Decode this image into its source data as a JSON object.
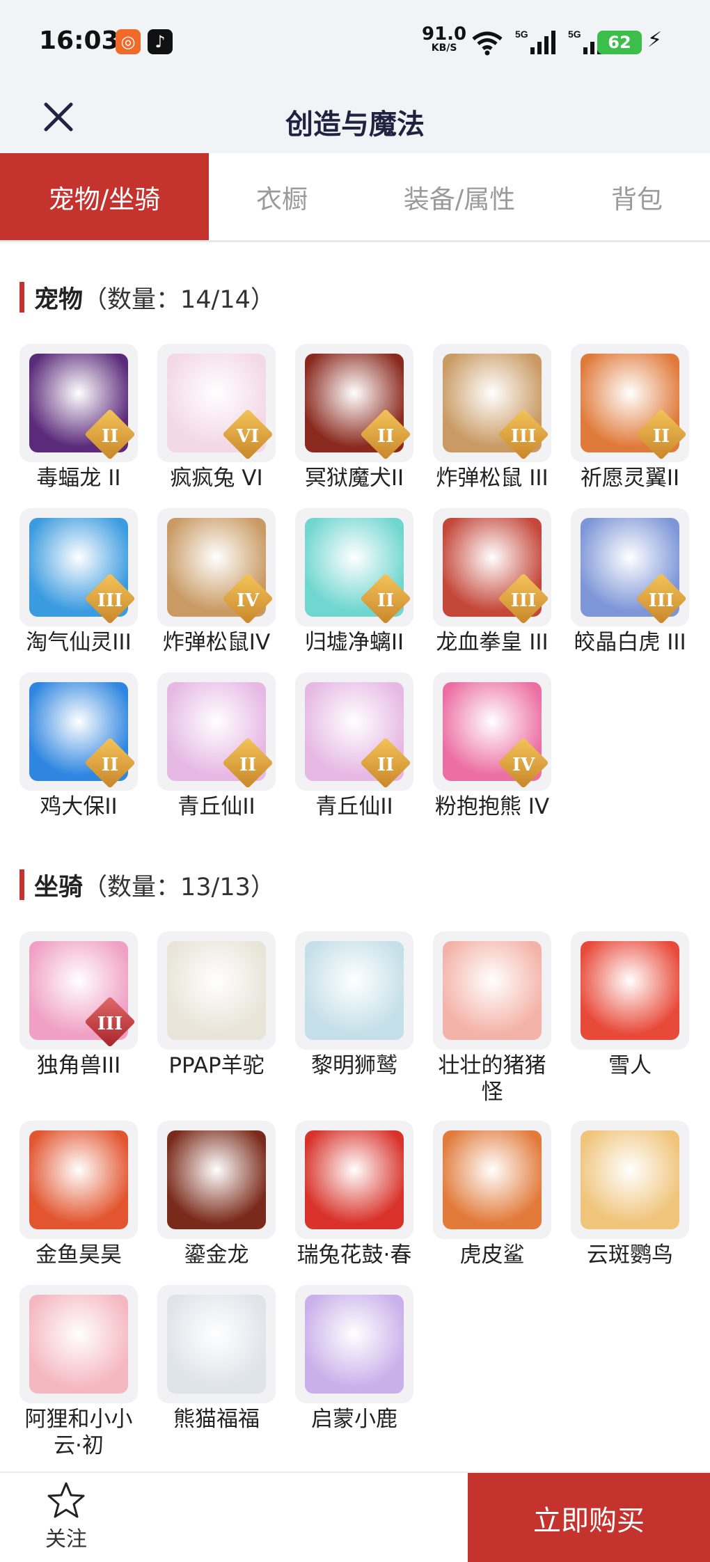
{
  "status_bar": {
    "time": "16:03",
    "net_speed": "91.0",
    "net_unit": "KB/S",
    "battery": "62",
    "signal_1": "5G",
    "signal_2": "5G"
  },
  "header": {
    "title": "创造与魔法"
  },
  "tabs": [
    {
      "label": "宠物/坐骑",
      "active": true
    },
    {
      "label": "衣橱",
      "active": false
    },
    {
      "label": "装备/属性",
      "active": false
    },
    {
      "label": "背包",
      "active": false
    }
  ],
  "pets": {
    "title": "宠物",
    "count": "（数量：14/14）",
    "items": [
      {
        "name": "毒蝠龙 II",
        "tier": "II",
        "color": "#5b2a7a"
      },
      {
        "name": "疯疯兔 VI",
        "tier": "VI",
        "color": "#f3d8e6"
      },
      {
        "name": "冥狱魔犬II",
        "tier": "II",
        "color": "#8a2a1f"
      },
      {
        "name": "炸弹松鼠 III",
        "tier": "III",
        "color": "#c99a63"
      },
      {
        "name": "祈愿灵翼II",
        "tier": "II",
        "color": "#e07a3a"
      },
      {
        "name": "淘气仙灵III",
        "tier": "III",
        "color": "#3b9be0"
      },
      {
        "name": "炸弹松鼠IV",
        "tier": "IV",
        "color": "#c99a63"
      },
      {
        "name": "归墟净螭II",
        "tier": "II",
        "color": "#6fd6d0"
      },
      {
        "name": "龙血拳皇 III",
        "tier": "III",
        "color": "#c4473a"
      },
      {
        "name": "皎晶白虎 III",
        "tier": "III",
        "color": "#7d96d8"
      },
      {
        "name": "鸡大保II",
        "tier": "II",
        "color": "#2f86e0"
      },
      {
        "name": "青丘仙II",
        "tier": "II",
        "color": "#e6b8e4"
      },
      {
        "name": "青丘仙II",
        "tier": "II",
        "color": "#e6b8e4"
      },
      {
        "name": "粉抱抱熊 IV",
        "tier": "IV",
        "color": "#ec6fa3"
      }
    ]
  },
  "mounts": {
    "title": "坐骑",
    "count": "（数量：13/13）",
    "items": [
      {
        "name": "独角兽III",
        "tier": "III",
        "color": "#f0a0c4"
      },
      {
        "name": "PPAP羊驼",
        "tier": "",
        "color": "#e8e4d8"
      },
      {
        "name": "黎明狮鹫",
        "tier": "",
        "color": "#c4dfe8"
      },
      {
        "name": "壮壮的猪猪怪",
        "tier": "",
        "color": "#f4b3a8"
      },
      {
        "name": "雪人",
        "tier": "",
        "color": "#e84a3a"
      },
      {
        "name": "金鱼昊昊",
        "tier": "",
        "color": "#e2552f"
      },
      {
        "name": "鎏金龙",
        "tier": "",
        "color": "#7a2a1a"
      },
      {
        "name": "瑞兔花鼓·春",
        "tier": "",
        "color": "#d8322a"
      },
      {
        "name": "虎皮鲨",
        "tier": "",
        "color": "#e27a3a"
      },
      {
        "name": "云斑鹦鸟",
        "tier": "",
        "color": "#f0c47a"
      },
      {
        "name": "阿狸和小小云·初",
        "tier": "",
        "color": "#f5b8c0"
      },
      {
        "name": "熊猫福福",
        "tier": "",
        "color": "#dfe3ea"
      },
      {
        "name": "启蒙小鹿",
        "tier": "",
        "color": "#c9b0ea"
      }
    ]
  },
  "bottom": {
    "fav_label": "关注",
    "buy_label": "立即购买"
  }
}
